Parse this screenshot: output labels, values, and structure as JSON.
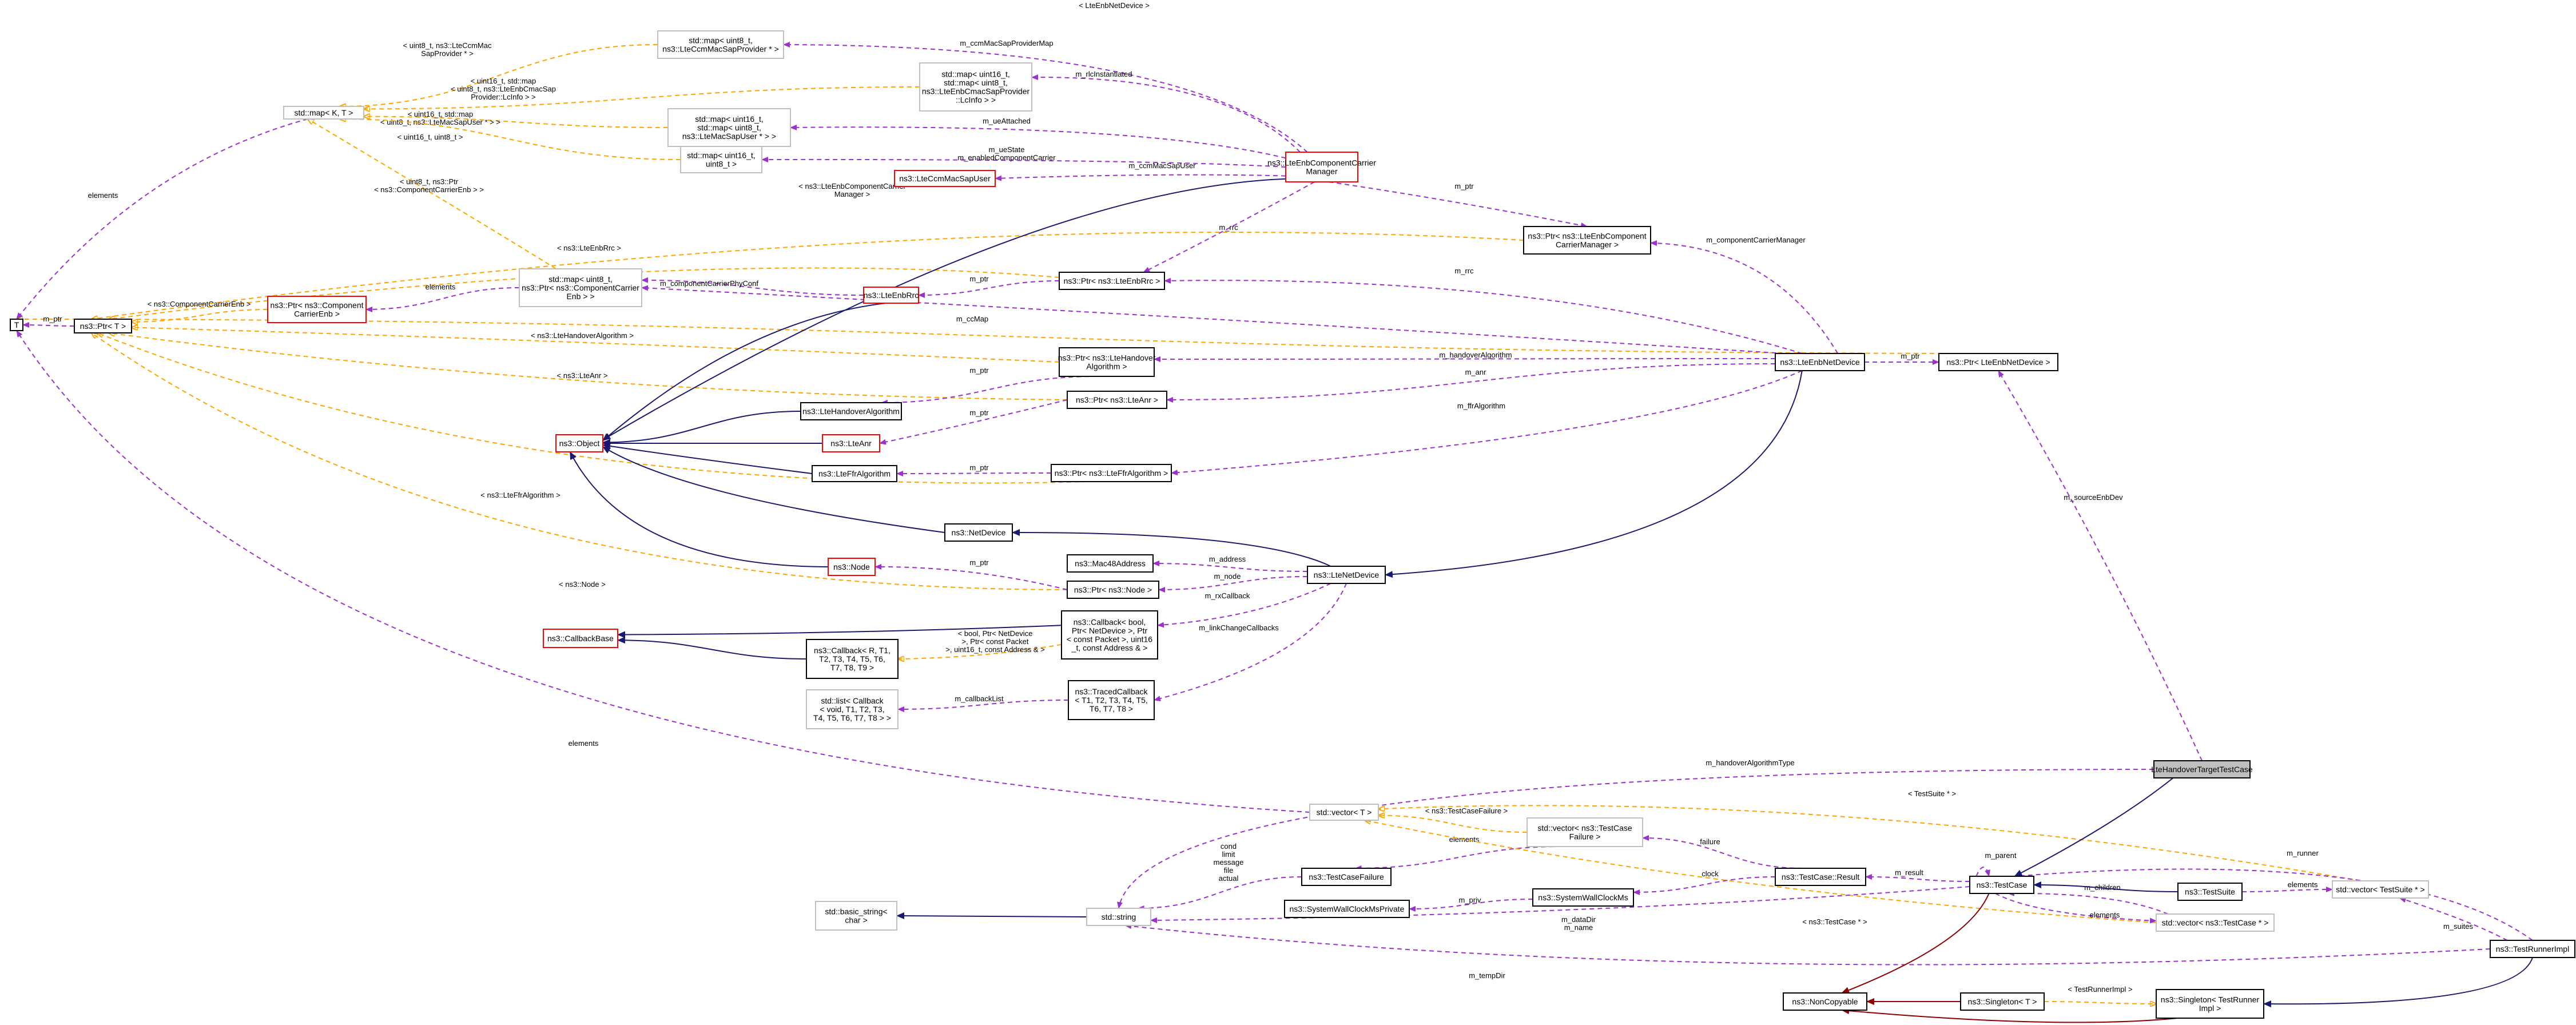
{
  "colors": {
    "usage": "#9a32cd",
    "template": "#ffa500",
    "inheritance": "#191970",
    "noncopy": "#8b0000",
    "red_border": "#ff0000",
    "grey_border": "#bfbfbf",
    "focus_fill": "#bfbfbf"
  },
  "nodes": {
    "T": [
      "T"
    ],
    "ptr_T": [
      "ns3::Ptr< T >"
    ],
    "map_K_T": [
      "std::map< K, T >"
    ],
    "map_ccm": [
      "std::map< uint8_t,",
      "ns3::LteCcmMacSapProvider * >"
    ],
    "map_lcinfo": [
      "std::map< uint16_t,",
      "std::map< uint8_t,",
      "ns3::LteEnbCmacSapProvider",
      "::LcInfo > >"
    ],
    "map_cmacuser": [
      "std::map< uint16_t,",
      "std::map< uint8_t,",
      "ns3::LteMacSapUser * > >"
    ],
    "map_u16_u8": [
      "std::map< uint16_t,",
      "uint8_t >"
    ],
    "ccm_user": [
      "ns3::LteCcmMacSapUser"
    ],
    "ccm": [
      "ns3::LteEnbComponentCarrier",
      "Manager"
    ],
    "ptr_ccm": [
      "ns3::Ptr< ns3::LteEnbComponent",
      "CarrierManager >"
    ],
    "map_cc": [
      "std::map< uint8_t,",
      "ns3::Ptr< ns3::ComponentCarrier",
      "Enb > >"
    ],
    "ptr_cc": [
      "ns3::Ptr< ns3::Component",
      "CarrierEnb >"
    ],
    "rrc": [
      "ns3::LteEnbRrc"
    ],
    "ptr_rrc": [
      "ns3::Ptr< ns3::LteEnbRrc >"
    ],
    "ptr_ho": [
      "ns3::Ptr< ns3::LteHandover",
      "Algorithm >"
    ],
    "ho": [
      "ns3::LteHandoverAlgorithm"
    ],
    "ptr_anr": [
      "ns3::Ptr< ns3::LteAnr >"
    ],
    "anr": [
      "ns3::LteAnr"
    ],
    "object": [
      "ns3::Object"
    ],
    "ffr": [
      "ns3::LteFfrAlgorithm"
    ],
    "ptr_ffr": [
      "ns3::Ptr< ns3::LteFfrAlgorithm >"
    ],
    "enbdev": [
      "ns3::LteEnbNetDevice"
    ],
    "ptr_enbdev": [
      "ns3::Ptr< LteEnbNetDevice >"
    ],
    "netdev": [
      "ns3::NetDevice"
    ],
    "node": [
      "ns3::Node"
    ],
    "mac48": [
      "ns3::Mac48Address"
    ],
    "ptr_node": [
      "ns3::Ptr< ns3::Node >"
    ],
    "ltenetdev": [
      "ns3::LteNetDevice"
    ],
    "cbbase": [
      "ns3::CallbackBase"
    ],
    "cb_generic": [
      "ns3::Callback< R, T1,",
      "T2, T3, T4, T5, T6,",
      "T7, T8, T9 >"
    ],
    "cb_bool": [
      "ns3::Callback< bool,",
      "Ptr< NetDevice >, Ptr",
      "< const Packet >, uint16",
      "_t, const Address & >"
    ],
    "list_cb": [
      "std::list< Callback",
      "< void, T1, T2, T3,",
      "T4, T5, T6, T7, T8 > >"
    ],
    "traced_cb": [
      "ns3::TracedCallback",
      "< T1, T2, T3, T4, T5,",
      "T6, T7, T8 >"
    ],
    "testcase_main": [
      "LteHandoverTargetTestCase"
    ],
    "vector_T": [
      "std::vector< T >"
    ],
    "vec_failure": [
      "std::vector< ns3::TestCase",
      "Failure >"
    ],
    "tcfailure": [
      "ns3::TestCaseFailure"
    ],
    "wallclock": [
      "ns3::SystemWallClockMs"
    ],
    "wallclock_priv": [
      "ns3::SystemWallClockMsPrivate"
    ],
    "tcresult": [
      "ns3::TestCase::Result"
    ],
    "testcase": [
      "ns3::TestCase"
    ],
    "testsuite": [
      "ns3::TestSuite"
    ],
    "vec_suite": [
      "std::vector< TestSuite * >"
    ],
    "basic_string": [
      "std::basic_string<",
      "char >"
    ],
    "stdstring": [
      "std::string"
    ],
    "vec_tc": [
      "std::vector< ns3::TestCase * >"
    ],
    "runner": [
      "ns3::TestRunnerImpl"
    ],
    "noncopyable": [
      "ns3::NonCopyable"
    ],
    "singleton": [
      "ns3::Singleton< T >"
    ],
    "singleton_runner": [
      "ns3::Singleton< TestRunner",
      "Impl >"
    ]
  },
  "edge_labels": {
    "ptr_enbdev_T": [
      "< LteEnbNetDevice >"
    ],
    "ccm_mapccm": [
      "m_ccmMacSapProviderMap"
    ],
    "mapccm_mapKT": [
      "< uint8_t, ns3::LteCcmMac",
      "SapProvider * >"
    ],
    "ccm_lcinfo": [
      "m_rlcInstantiated"
    ],
    "lcinfo_mapKT": [
      "< uint16_t, std::map",
      "< uint8_t, ns3::LteEnbCmacSap",
      "Provider::LcInfo > >"
    ],
    "ccm_cmacuser": [
      "m_ueAttached"
    ],
    "cmacuser_mapKT": [
      "< uint16_t, std::map",
      "< uint8_t, ns3::LteMacSapUser * > >"
    ],
    "ccm_u16u8": [
      "m_ueState",
      "m_enabledComponentCarrier"
    ],
    "u16u8_mapKT": [
      "< uint16_t, uint8_t >"
    ],
    "ccm_ccmuser": [
      "m_ccmMacSapUser"
    ],
    "mapKT_T": [
      "elements"
    ],
    "mapcc_mapKT": [
      "< uint8_t, ns3::Ptr",
      "< ns3::ComponentCarrierEnb > >"
    ],
    "ptrccm_ptrT": [
      "< ns3::LteEnbComponentCarrier",
      "Manager >"
    ],
    "ptrrrc_ptrT": [
      "< ns3::LteEnbRrc >"
    ],
    "ptrcc_ptrT": [
      "< ns3::ComponentCarrierEnb >"
    ],
    "mapcc_ptrcc": [
      "elements"
    ],
    "ptrho_ptrT": [
      "< ns3::LteHandoverAlgorithm >"
    ],
    "ptranr_ptrT": [
      "< ns3::LteAnr >"
    ],
    "ptrffr_ptrT": [
      "< ns3::LteFfrAlgorithm >"
    ],
    "ptrnode_ptrT": [
      "< ns3::Node >"
    ],
    "ptrT_T": [
      "m_ptr"
    ],
    "ccm_ptrccm": [
      "m_ptr"
    ],
    "ccm_rrc": [
      "m_rrc"
    ],
    "rrc_ptrrrc": [
      "m_ptr"
    ],
    "enbdev_ptrccm": [
      "m_componentCarrierManager"
    ],
    "enbdev_ptrrrc": [
      "m_rrc"
    ],
    "enbdev_mapcc": [
      "m_ccMap"
    ],
    "rrc_mapcc": [
      "m_componentCarrierPhyConf"
    ],
    "ho_ptrho": [
      "m_ptr"
    ],
    "enbdev_ptrho": [
      "m_handoverAlgorithm"
    ],
    "anr_ptranr": [
      "m_ptr"
    ],
    "enbdev_ptranr": [
      "m_anr"
    ],
    "ffr_ptrffr": [
      "m_ptr"
    ],
    "enbdev_ptrffr": [
      "m_ffrAlgorithm"
    ],
    "enbdev_ptrenb": [
      "m_ptr"
    ],
    "ptrenb_tc": [
      "m_sourceEnbDev"
    ],
    "node_ptrnode": [
      "m_ptr"
    ],
    "lte_mac": [
      "m_address"
    ],
    "lte_ptrnode": [
      "m_node"
    ],
    "lte_cbbool": [
      "m_rxCallback"
    ],
    "lte_traced": [
      "m_linkChangeCallbacks"
    ],
    "cbgen_cbbool": [
      "< bool, Ptr< NetDevice",
      ">, Ptr< const Packet",
      ">, uint16_t, const Address & >"
    ],
    "listcb_traced": [
      "m_callbackList"
    ],
    "vecT_T": [
      "elements"
    ],
    "tc_string": [
      "m_handoverAlgorithmType"
    ],
    "tcf_string": [
      "cond",
      "limit",
      "message",
      "file",
      "actual"
    ],
    "vecfail_vecT": [
      "< ns3::TestCaseFailure >"
    ],
    "tcf_vecfail": [
      "elements"
    ],
    "vecsuite_vecT": [
      "< TestSuite * >"
    ],
    "vectc_vecT": [
      "< ns3::TestCase * >"
    ],
    "vecfail_result": [
      "failure"
    ],
    "wall_result": [
      "clock"
    ],
    "priv_wall": [
      "m_priv"
    ],
    "result_tc": [
      "m_result"
    ],
    "string_tc": [
      "m_dataDir",
      "m_name"
    ],
    "tc_tc": [
      "m_parent"
    ],
    "vectc_tc": [
      "m_children"
    ],
    "tc_vectc": [
      "elements"
    ],
    "suite_vecsuite": [
      "elements"
    ],
    "vecsuite_runner": [
      "m_suites"
    ],
    "tc_runner": [
      "m_runner"
    ],
    "string_runner": [
      "m_tempDir"
    ],
    "singleton_sr": [
      "< TestRunnerImpl >"
    ]
  }
}
